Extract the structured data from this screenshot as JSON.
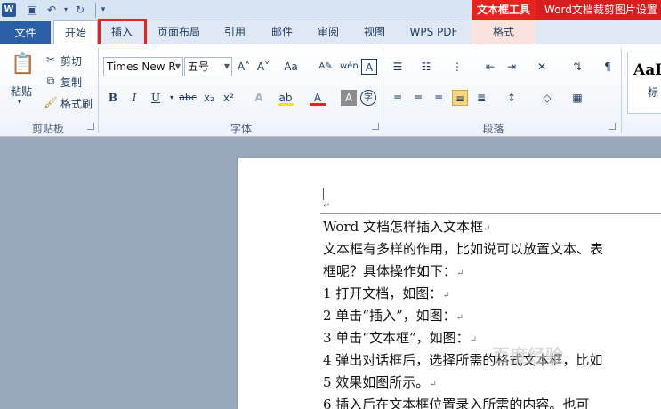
{
  "title_bar": {
    "app_icon": "W",
    "context_group": "文本框工具",
    "document_title": "Word文档裁剪图片设置"
  },
  "tabs": {
    "file": "文件",
    "items": [
      "开始",
      "插入",
      "页面布局",
      "引用",
      "邮件",
      "审阅",
      "视图",
      "WPS PDF",
      "格式"
    ]
  },
  "ribbon": {
    "clipboard": {
      "paste": "粘贴",
      "cut": "剪切",
      "copy": "复制",
      "format_painter": "格式刷",
      "group_label": "剪贴板"
    },
    "font": {
      "font_name": "Times New R",
      "font_size": "五号",
      "group_label": "字体",
      "grow": "A˄",
      "shrink": "A˅",
      "case": "Aa",
      "bold": "B",
      "italic": "I",
      "underline": "U",
      "strike": "abc",
      "subscript": "x₂",
      "superscript": "x²",
      "font_color": "A"
    },
    "paragraph": {
      "group_label": "段落"
    },
    "styles": {
      "preview": "AaI",
      "label": "标"
    }
  },
  "document": {
    "lines": [
      "Word 文档怎样插入文本框",
      "文本框有多样的作用，比如说可以放置文本、表",
      "框呢？具体操作如下：",
      "1 打开文档，如图：",
      "2 单击“插入”，如图：",
      "3 单击“文本框”，如图：",
      "4 弹出对话框后，选择所需的格式文本框，比如",
      "5 效果如图所示。",
      "6 插入后在文本框位置录入所需的内容。也可"
    ],
    "para_mark": "↵",
    "watermark": "百度经验"
  },
  "colors": {
    "accent_red": "#e8221d",
    "file_tab_blue": "#2a5fa8",
    "highlight": "#f8d77f"
  }
}
